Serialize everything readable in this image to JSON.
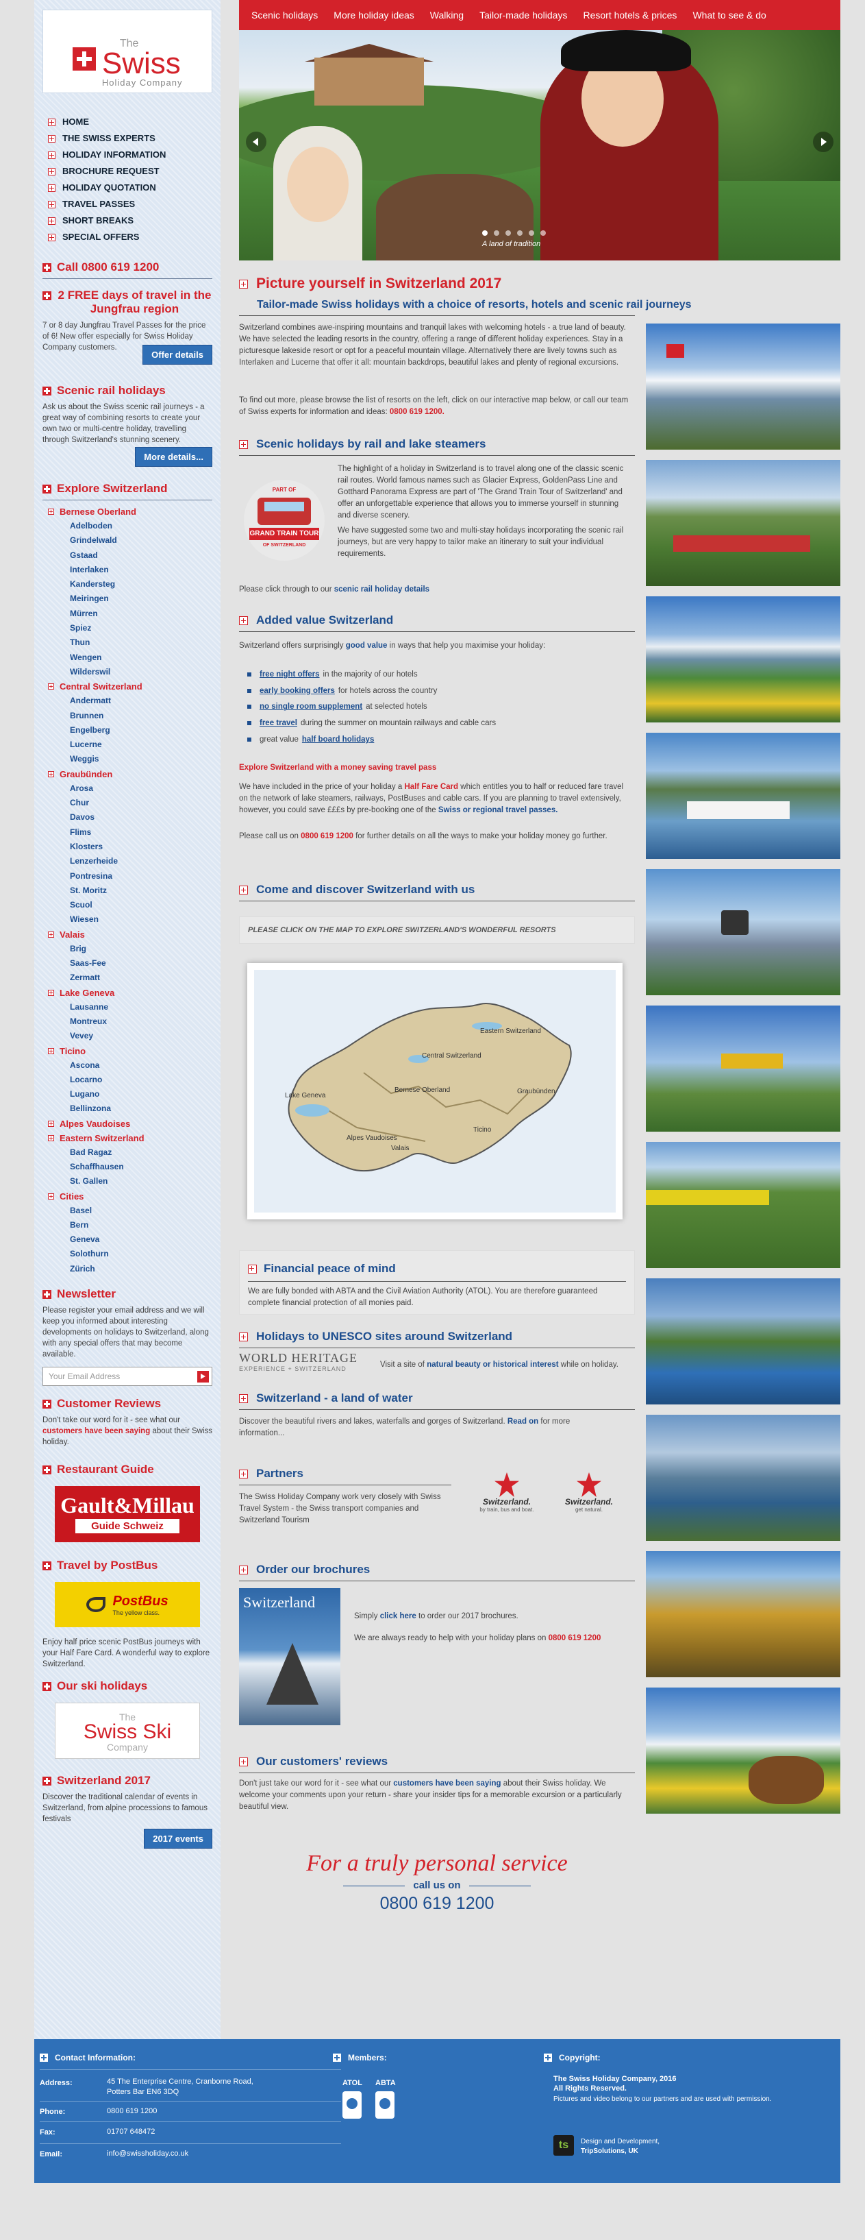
{
  "logo": {
    "the": "The",
    "swiss": "Swiss",
    "company": "Holiday Company"
  },
  "main_nav": [
    "HOME",
    "THE SWISS EXPERTS",
    "HOLIDAY INFORMATION",
    "BROCHURE REQUEST",
    "HOLIDAY QUOTATION",
    "TRAVEL PASSES",
    "SHORT BREAKS",
    "SPECIAL OFFERS"
  ],
  "sidebar": {
    "phone": "Call 0800 619 1200",
    "jungfrau_title": "2 FREE days of travel in the Jungfrau region",
    "jungfrau_text": "7 or 8 day Jungfrau Travel Passes for the price of 6! New offer especially for Swiss Holiday Company customers.",
    "offer_button": "Offer details",
    "rail_title": "Scenic rail holidays",
    "rail_text": "Ask us about the Swiss scenic rail journeys - a great way of combining resorts to create your own two or multi-centre holiday, travelling through Switzerland's stunning scenery.",
    "rail_button": "More details...",
    "explore_title": "Explore Switzerland",
    "regions": [
      {
        "name": "Bernese Oberland",
        "towns": [
          "Adelboden",
          "Grindelwald",
          "Gstaad",
          "Interlaken",
          "Kandersteg",
          "Meiringen",
          "Mürren",
          "Spiez",
          "Thun",
          "Wengen",
          "Wilderswil"
        ]
      },
      {
        "name": "Central Switzerland",
        "towns": [
          "Andermatt",
          "Brunnen",
          "Engelberg",
          "Lucerne",
          "Weggis"
        ]
      },
      {
        "name": "Graubünden",
        "towns": [
          "Arosa",
          "Chur",
          "Davos",
          "Flims",
          "Klosters",
          "Lenzerheide",
          "Pontresina",
          "St. Moritz",
          "Scuol",
          "Wiesen"
        ]
      },
      {
        "name": "Valais",
        "towns": [
          "Brig",
          "Saas-Fee",
          "Zermatt"
        ]
      },
      {
        "name": "Lake Geneva",
        "towns": [
          "Lausanne",
          "Montreux",
          "Vevey"
        ]
      },
      {
        "name": "Ticino",
        "towns": [
          "Ascona",
          "Locarno",
          "Lugano",
          "Bellinzona"
        ]
      },
      {
        "name": "Alpes Vaudoises",
        "towns": []
      },
      {
        "name": "Eastern Switzerland",
        "towns": [
          "Bad Ragaz",
          "Schaffhausen",
          "St. Gallen"
        ]
      },
      {
        "name": "Cities",
        "towns": [
          "Basel",
          "Bern",
          "Geneva",
          "Solothurn",
          "Zürich"
        ]
      }
    ],
    "newsletter_title": "Newsletter",
    "newsletter_text": "Please register your email address and we will keep you informed about interesting developments on holidays to Switzerland, along with any special offers that may become available.",
    "email_placeholder": "Your Email Address",
    "reviews_title": "Customer Reviews",
    "reviews_text_a": "Don't take our word for it - see what our",
    "reviews_link": "customers have been saying",
    "reviews_text_b": "about their Swiss holiday.",
    "restaurant_title": "Restaurant Guide",
    "gm_line1": "Gault&Millau",
    "gm_line2": "Guide Schweiz",
    "postbus_title": "Travel by PostBus",
    "postbus_logo": "PostBus",
    "postbus_tagline": "The yellow class.",
    "postbus_text": "Enjoy half price scenic PostBus journeys with your Half Fare Card. A wonderful way to explore Switzerland.",
    "ski_title": "Our ski holidays",
    "ski_the": "The",
    "ski_swiss": "Swiss Ski",
    "ski_company": "Company",
    "events_title": "Switzerland 2017",
    "events_text": "Discover the traditional calendar of events in Switzerland, from alpine processions to famous festivals",
    "events_button": "2017 events"
  },
  "top_nav": [
    "Scenic holidays",
    "More holiday ideas",
    "Walking",
    "Tailor-made holidays",
    "Resort hotels & prices",
    "What to see & do"
  ],
  "hero": {
    "caption": "A land of tradition"
  },
  "main": {
    "title": "Picture yourself in Switzerland 2017",
    "subtitle": "Tailor-made Swiss holidays with a choice of resorts, hotels and scenic rail journeys",
    "intro1": "Switzerland combines awe-inspiring mountains and tranquil lakes with welcoming hotels - a true land of beauty. We have selected the leading resorts in the country, offering a range of different holiday experiences. Stay in a picturesque lakeside resort or opt for a peaceful mountain village. Alternatively there are lively towns such as Interlaken and Lucerne that offer it all: mountain backdrops, beautiful lakes and plenty of regional excursions.",
    "intro2_a": "To find out more, please browse the list of resorts on the left, click on our interactive map below, or call our team of Swiss experts for information and ideas:",
    "intro2_phone": "0800 619 1200.",
    "rail_heading": "Scenic holidays by rail and lake steamers",
    "train_logo_top": "PART OF",
    "train_logo_band": "GRAND TRAIN TOUR",
    "train_logo_bottom": "OF SWITZERLAND",
    "rail_p1": "The highlight of a holiday in Switzerland is to travel along one of the classic scenic rail routes. World famous names such as Glacier Express, GoldenPass Line and Gotthard Panorama Express are part of 'The Grand Train Tour of Switzerland' and offer an unforgettable experience that allows you to immerse yourself in stunning and diverse scenery.",
    "rail_p2": "We have suggested some two and multi-stay holidays incorporating the scenic rail journeys, but are very happy to tailor make an itinerary to suit your individual requirements.",
    "rail_p3_a": "Please click through to our",
    "rail_p3_link": "scenic rail holiday details",
    "value_heading": "Added value Switzerland",
    "value_p_a": "Switzerland offers surprisingly",
    "value_p_link": "good value",
    "value_p_b": "in ways that help you maximise your holiday:",
    "value_list": [
      {
        "link": "free night offers",
        "text": "in the majority of our hotels"
      },
      {
        "link": "early booking offers",
        "text": "for hotels across the country"
      },
      {
        "link": "no single room supplement",
        "text": "at selected hotels"
      },
      {
        "link": "free travel",
        "text": "during the summer on mountain railways and cable cars"
      },
      {
        "pre": "great value",
        "link": "half board holidays",
        "text": ""
      }
    ],
    "travel_pass_heading": "Explore Switzerland with a money saving travel pass",
    "pass_p1_a": "We have included in the price of your holiday a",
    "pass_p1_link": "Half Fare Card",
    "pass_p1_b": "which entitles you to half or reduced fare travel on the network of lake steamers, railways, PostBuses and cable cars. If you are planning to travel extensively, however, you could save £££s by pre-booking one of the",
    "pass_p1_link2": "Swiss or regional travel passes.",
    "pass_p2_a": "Please call us on",
    "pass_p2_phone": "0800 619 1200",
    "pass_p2_b": "for further details on all the ways to make your holiday money go further.",
    "discover_heading": "Come and discover Switzerland with us",
    "map_bar": "PLEASE CLICK ON THE MAP TO EXPLORE SWITZERLAND'S WONDERFUL RESORTS",
    "map_labels": [
      "Eastern Switzerland",
      "Central Switzerland",
      "Lake Geneva",
      "Bernese Oberland",
      "Graubünden",
      "Ticino",
      "Alpes Vaudoises",
      "Valais"
    ],
    "financial_heading": "Financial peace of mind",
    "financial_p": "We are fully bonded with ABTA and the Civil Aviation Authority (ATOL). You are therefore guaranteed complete financial protection of all monies paid.",
    "unesco_heading": "Holidays to UNESCO sites around Switzerland",
    "wh_line1": "WORLD HERITAGE",
    "wh_line2": "EXPERIENCE + SWITZERLAND",
    "unesco_p_a": "Visit a site of",
    "unesco_p_link": "natural beauty or historical interest",
    "unesco_p_b": "while on holiday.",
    "water_heading": "Switzerland - a land of water",
    "water_p_a": "Discover the beautiful rivers and lakes, waterfalls and gorges of Switzerland.",
    "water_p_link": "Read on",
    "water_p_b": "for more information...",
    "partners_heading": "Partners",
    "partners_p": "The Swiss Holiday Company work very closely with Swiss Travel System - the Swiss transport companies and Switzerland Tourism",
    "partner1_name": "Switzerland.",
    "partner1_tag": "by train, bus and boat.",
    "partner2_name": "Switzerland.",
    "partner2_tag": "get natural.",
    "brochures_heading": "Order our brochures",
    "brochure_cover": "Switzerland",
    "broch_p1_a": "Simply",
    "broch_p1_link": "click here",
    "broch_p1_b": "to order our 2017 brochures.",
    "broch_p2_a": "We are always ready to help with your holiday plans on",
    "broch_p2_phone": "0800 619 1200",
    "reviews_heading": "Our customers' reviews",
    "reviews_p_a": "Don't just take our word for it - see what our",
    "reviews_p_link": "customers have been saying",
    "reviews_p_b": "about their Swiss holiday. We welcome your comments upon your return - share your insider tips for a memorable excursion or a particularly beautiful view.",
    "personal_title": "For a truly personal service",
    "personal_call": "call us on",
    "personal_phone": "0800 619 1200"
  },
  "footer": {
    "contact_heading": "Contact Information:",
    "address_label": "Address:",
    "address": "45 The Enterprise Centre, Cranborne Road, Potters Bar EN6 3DQ",
    "phone_label": "Phone:",
    "phone": "0800 619 1200",
    "fax_label": "Fax:",
    "fax": "01707 648472",
    "email_label": "Email:",
    "email": "info@swissholiday.co.uk",
    "members_heading": "Members:",
    "atol": "ATOL",
    "abta": "ABTA",
    "copyright_heading": "Copyright:",
    "copyright1": "The Swiss Holiday Company, 2016",
    "copyright2": "All Rights Reserved.",
    "copyright3": "Pictures and video belong to our partners and are used with permission.",
    "design1": "Design and Development,",
    "design2": "TripSolutions, UK",
    "ts_logo": "ts"
  },
  "colors": {
    "brand_red": "#d3222a",
    "brand_blue": "#1d4e8f",
    "footer_blue": "#2f70b8"
  }
}
